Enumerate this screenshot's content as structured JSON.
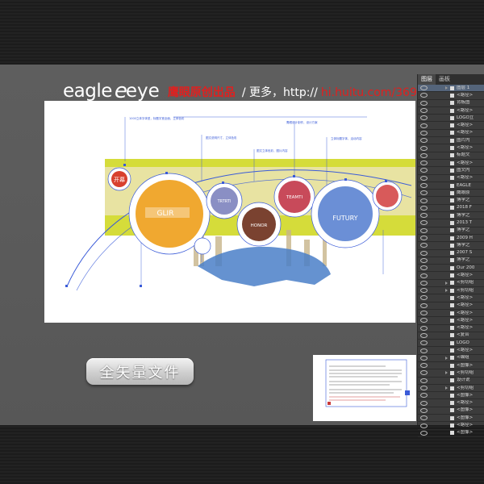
{
  "brand": {
    "logo_left": "eagle",
    "logo_e": "e",
    "logo_right": "eye",
    "chinese_name": "鹰眼原创出品",
    "more": "/ 更多，http://",
    "url_host": "hi.huitu.com/369/"
  },
  "vector_button": {
    "label": "全矢量文件"
  },
  "layers_panel": {
    "tabs": [
      "图层",
      "画板"
    ],
    "rows": [
      {
        "name": "图层 1"
      },
      {
        "name": "<路径>"
      },
      {
        "name": "背板图"
      },
      {
        "name": "<路径>"
      },
      {
        "name": "LOGO立"
      },
      {
        "name": "<路径>"
      },
      {
        "name": "<路径>"
      },
      {
        "name": "图片内"
      },
      {
        "name": "<路径>"
      },
      {
        "name": "标题文"
      },
      {
        "name": "<路径>"
      },
      {
        "name": "图文内"
      },
      {
        "name": "<路径>"
      },
      {
        "name": "EAGLE"
      },
      {
        "name": "鹰眼原"
      },
      {
        "name": "博学之"
      },
      {
        "name": "2018 F"
      },
      {
        "name": "博学之"
      },
      {
        "name": "2013 T"
      },
      {
        "name": "博学之"
      },
      {
        "name": "2009 H"
      },
      {
        "name": "博学之"
      },
      {
        "name": "2007 S"
      },
      {
        "name": "博学之"
      },
      {
        "name": "Our 200"
      },
      {
        "name": "<路径>"
      },
      {
        "name": "<剪切组"
      },
      {
        "name": "<剪切组"
      },
      {
        "name": "<路径>"
      },
      {
        "name": "<路径>"
      },
      {
        "name": "<路径>"
      },
      {
        "name": "<路径>"
      },
      {
        "name": "<路径>"
      },
      {
        "name": "<复合"
      },
      {
        "name": "LOGO"
      },
      {
        "name": "<路径>"
      },
      {
        "name": "<编组"
      },
      {
        "name": "<图像>"
      },
      {
        "name": "<剪切组"
      },
      {
        "name": "设计说"
      },
      {
        "name": "<剪切组"
      },
      {
        "name": "<图像>"
      },
      {
        "name": "<路径>"
      },
      {
        "name": "<图像>"
      },
      {
        "name": "<图像>"
      },
      {
        "name": "<路径>"
      },
      {
        "name": "<图像>"
      }
    ]
  },
  "artwork": {
    "circle_labels": [
      "开幕",
      "GLIR",
      "TRTRTI",
      "HONOR",
      "TEAMTI",
      "FUTURY"
    ],
    "circle_colors": [
      "#d8402e",
      "#f0a830",
      "#8a8fc4",
      "#7a4230",
      "#c84a5a",
      "#6b8fd6",
      "#d85a5a"
    ],
    "accent": "#d5dc3a",
    "guide_color": "#3a5bd8"
  }
}
